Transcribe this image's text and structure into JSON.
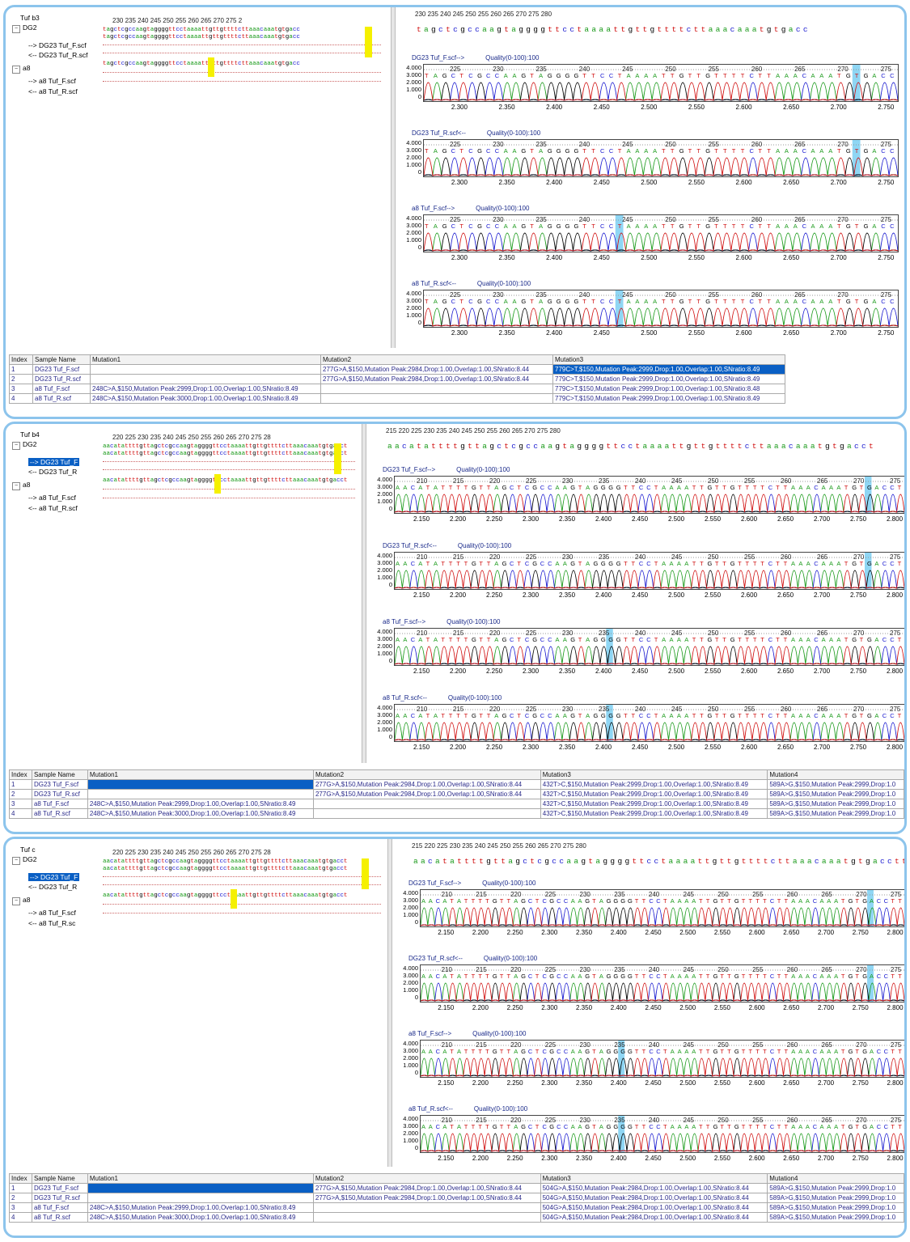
{
  "panels": [
    {
      "id": "p1",
      "group": "Tuf b3",
      "node1": "DG2",
      "node1_items": [
        "--> DG23 Tuf_F.scf",
        "<-- DG23 Tuf_R.scf"
      ],
      "node2": "a8",
      "node2_items": [
        "--> a8 Tuf_F.scf",
        "<-- a8 Tuf_R.scf"
      ],
      "align_ruler": "230    235    240    245    250    255    260    265    270    275    2",
      "seq_ref": "tagctcgccaagtaggggttcctaaaattgttgttttcttaaacaaatgtgacc",
      "seq_top_ruler": "230          235          240          245          250          255          260          265          270          275          280",
      "seq_top": "tagctcgccaagtaggggttcctaaaattgttgttttcttaaacaaatgtgacc",
      "chromas": [
        {
          "title": "DG23 Tuf_F.scf-->",
          "quality": "Quality(0-100):100"
        },
        {
          "title": "DG23 Tuf_R.scf<--",
          "quality": "Quality(0-100):100"
        },
        {
          "title": "a8 Tuf_F.scf-->",
          "quality": "Quality(0-100):100"
        },
        {
          "title": "a8 Tuf_R.scf<--",
          "quality": "Quality(0-100):100"
        }
      ],
      "ruler_in": [
        "225",
        "230",
        "235",
        "240",
        "245",
        "250",
        "255",
        "260",
        "265",
        "270",
        "275"
      ],
      "x_ticks": [
        "2.300",
        "2.350",
        "2.400",
        "2.450",
        "2.500",
        "2.550",
        "2.600",
        "2.650",
        "2.700",
        "2.750"
      ],
      "y_ticks": [
        "4.000",
        "3.000",
        "2.000",
        "1.000",
        "0"
      ],
      "table": {
        "headers": [
          "Index",
          "Sample Name",
          "Mutation1",
          "Mutation2",
          "Mutation3"
        ],
        "rows": [
          [
            "1",
            "DG23 Tuf_F.scf",
            "",
            "277G>A,$150,Mutation Peak:2984,Drop:1.00,Overlap:1.00,SNratio:8.44",
            "779C>T,$150,Mutation Peak:2999,Drop:1.00,Overlap:1.00,SNratio:8.49"
          ],
          [
            "2",
            "DG23 Tuf_R.scf",
            "",
            "277G>A,$150,Mutation Peak:2984,Drop:1.00,Overlap:1.00,SNratio:8.44",
            "779C>T,$150,Mutation Peak:2999,Drop:1.00,Overlap:1.00,SNratio:8.49"
          ],
          [
            "3",
            "a8 Tuf_F.scf",
            "248C>A,$150,Mutation Peak:2999,Drop:1.00,Overlap:1.00,SNratio:8.49",
            "",
            "779C>T,$150,Mutation Peak:2999,Drop:1.00,Overlap:1.00,SNratio:8.48"
          ],
          [
            "4",
            "a8 Tuf_R.scf",
            "248C>A,$150,Mutation Peak:3000,Drop:1.00,Overlap:1.00,SNratio:8.49",
            "",
            "779C>T,$150,Mutation Peak:2999,Drop:1.00,Overlap:1.00,SNratio:8.49"
          ]
        ]
      }
    },
    {
      "id": "p2",
      "group": "Tuf b4",
      "node1": "DG2",
      "node1_items": [
        "--> DG23 Tuf_F",
        "<-- DG23 Tuf_R"
      ],
      "node2": "a8",
      "node2_items": [
        "--> a8 Tuf_F.scf",
        "<-- a8 Tuf_R.scf"
      ],
      "align_ruler": "220  225  230  235  240  245  250  255  260  265  270  275  28",
      "seq_ref": "aacatattttgttagctcgccaagtaggggttcctaaaattgttgttttcttaaacaaatgtgacct",
      "seq_top_ruler": "215         220         225         230         235         240         245         250         255         260         265         270         275         280",
      "seq_top": "aacatattttgttagctcgccaagtaggggttcctaaaattgttgttttcttaaacaaatgtgacct",
      "chromas": [
        {
          "title": "DG23 Tuf_F.scf-->",
          "quality": "Quality(0-100):100"
        },
        {
          "title": "DG23 Tuf_R.scf<--",
          "quality": "Quality(0-100):100"
        },
        {
          "title": "a8 Tuf_F.scf-->",
          "quality": "Quality(0-100):100"
        },
        {
          "title": "a8 Tuf_R.scf<--",
          "quality": "Quality(0-100):100"
        }
      ],
      "ruler_in": [
        "210",
        "215",
        "220",
        "225",
        "230",
        "235",
        "240",
        "245",
        "250",
        "255",
        "260",
        "265",
        "270",
        "275"
      ],
      "x_ticks": [
        "2.150",
        "2.200",
        "2.250",
        "2.300",
        "2.350",
        "2.400",
        "2.450",
        "2.500",
        "2.550",
        "2.600",
        "2.650",
        "2.700",
        "2.750",
        "2.800"
      ],
      "y_ticks": [
        "4.000",
        "3.000",
        "2.000",
        "1.000",
        "0"
      ],
      "table": {
        "headers": [
          "Index",
          "Sample Name",
          "Mutation1",
          "Mutation2",
          "Mutation3",
          "Mutation4"
        ],
        "rows": [
          [
            "1",
            "DG23 Tuf_F.scf",
            "",
            "277G>A,$150,Mutation Peak:2984,Drop:1.00,Overlap:1.00,SNratio:8.44",
            "432T>C,$150,Mutation Peak:2999,Drop:1.00,Overlap:1.00,SNratio:8.49",
            "589A>G,$150,Mutation Peak:2999,Drop:1.0"
          ],
          [
            "2",
            "DG23 Tuf_R.scf",
            "",
            "277G>A,$150,Mutation Peak:2984,Drop:1.00,Overlap:1.00,SNratio:8.44",
            "432T>C,$150,Mutation Peak:2999,Drop:1.00,Overlap:1.00,SNratio:8.49",
            "589A>G,$150,Mutation Peak:2999,Drop:1.0"
          ],
          [
            "3",
            "a8 Tuf_F.scf",
            "248C>A,$150,Mutation Peak:2999,Drop:1.00,Overlap:1.00,SNratio:8.49",
            "",
            "432T>C,$150,Mutation Peak:2999,Drop:1.00,Overlap:1.00,SNratio:8.49",
            "589A>G,$150,Mutation Peak:2999,Drop:1.0"
          ],
          [
            "4",
            "a8 Tuf_R.scf",
            "248C>A,$150,Mutation Peak:3000,Drop:1.00,Overlap:1.00,SNratio:8.49",
            "",
            "432T>C,$150,Mutation Peak:2999,Drop:1.00,Overlap:1.00,SNratio:8.49",
            "589A>G,$150,Mutation Peak:2999,Drop:1.0"
          ]
        ]
      }
    },
    {
      "id": "p3",
      "group": "Tuf c",
      "node1": "DG2",
      "node1_items": [
        "--> DG23 Tuf_F",
        "<-- DG23 Tuf_R"
      ],
      "node2": "a8",
      "node2_items": [
        "--> a8 Tuf_F.scf",
        "<-- a8 Tuf_R.sc"
      ],
      "align_ruler": "220  225  230  235  240  245  250  255  260  265  270  275  28",
      "seq_ref": "aacatattttgttagctcgccaagtaggggttcctaaaattgttgttttcttaaacaaatgtgacct",
      "seq_top_ruler": "215         220         225         230         235         240         245         250         255         260         265         270         275         280",
      "seq_top": "aacatattttgttagctcgccaagtaggggttcctaaaattgttgttttcttaaacaaatgtgacctt",
      "chromas": [
        {
          "title": "DG23 Tuf_F.scf-->",
          "quality": "Quality(0-100):100"
        },
        {
          "title": "DG23 Tuf_R.scf<--",
          "quality": "Quality(0-100):100"
        },
        {
          "title": "a8 Tuf_F.scf-->",
          "quality": "Quality(0-100):100"
        },
        {
          "title": "a8 Tuf_R.scf<--",
          "quality": "Quality(0-100):100"
        }
      ],
      "ruler_in": [
        "210",
        "215",
        "220",
        "225",
        "230",
        "235",
        "240",
        "245",
        "250",
        "255",
        "260",
        "265",
        "270",
        "275"
      ],
      "x_ticks": [
        "2.150",
        "2.200",
        "2.250",
        "2.300",
        "2.350",
        "2.400",
        "2.450",
        "2.500",
        "2.550",
        "2.600",
        "2.650",
        "2.700",
        "2.750",
        "2.800"
      ],
      "y_ticks": [
        "4.000",
        "3.000",
        "2.000",
        "1.000",
        "0"
      ],
      "table": {
        "headers": [
          "Index",
          "Sample Name",
          "Mutation1",
          "Mutation2",
          "Mutation3",
          "Mutation4"
        ],
        "rows": [
          [
            "1",
            "DG23 Tuf_F.scf",
            "",
            "277G>A,$150,Mutation Peak:2984,Drop:1.00,Overlap:1.00,SNratio:8.44",
            "504G>A,$150,Mutation Peak:2984,Drop:1.00,Overlap:1.00,SNratio:8.44",
            "589A>G,$150,Mutation Peak:2999,Drop:1.0"
          ],
          [
            "2",
            "DG23 Tuf_R.scf",
            "",
            "277G>A,$150,Mutation Peak:2984,Drop:1.00,Overlap:1.00,SNratio:8.44",
            "504G>A,$150,Mutation Peak:2984,Drop:1.00,Overlap:1.00,SNratio:8.44",
            "589A>G,$150,Mutation Peak:2999,Drop:1.0"
          ],
          [
            "3",
            "a8 Tuf_F.scf",
            "248C>A,$150,Mutation Peak:2999,Drop:1.00,Overlap:1.00,SNratio:8.49",
            "",
            "504G>A,$150,Mutation Peak:2984,Drop:1.00,Overlap:1.00,SNratio:8.44",
            "589A>G,$150,Mutation Peak:2999,Drop:1.0"
          ],
          [
            "4",
            "a8 Tuf_R.scf",
            "248C>A,$150,Mutation Peak:3000,Drop:1.00,Overlap:1.00,SNratio:8.49",
            "",
            "504G>A,$150,Mutation Peak:2984,Drop:1.00,Overlap:1.00,SNratio:8.44",
            "589A>G,$150,Mutation Peak:2999,Drop:1.0"
          ]
        ]
      }
    }
  ],
  "colors": {
    "A": "#1a9a1a",
    "C": "#1a1ad0",
    "G": "#000000",
    "T": "#d01010",
    "highlight": "#f5f000",
    "mutation_bar": "#8fd6f4",
    "frame": "#8cc4ec",
    "selected": "#0a5fc4"
  },
  "tree_icons": {
    "expand": "minus-box-icon"
  }
}
